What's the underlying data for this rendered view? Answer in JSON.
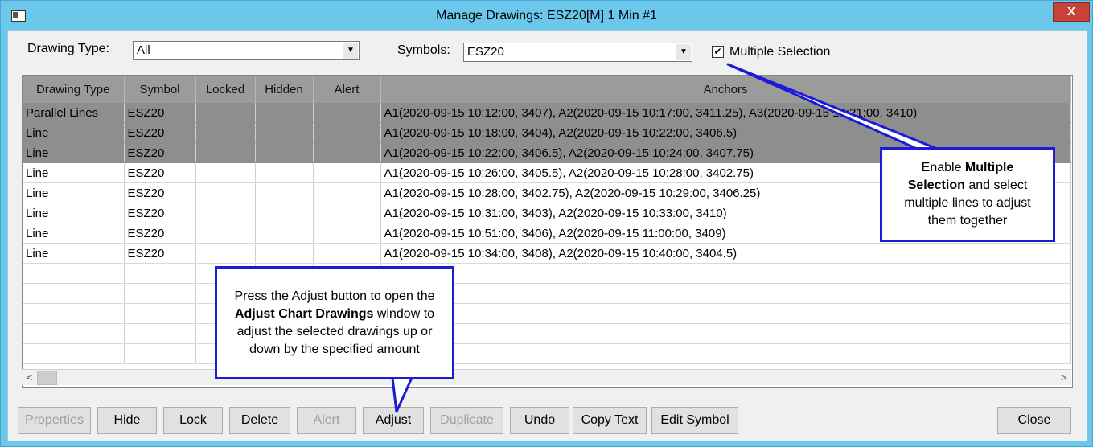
{
  "window": {
    "title": "Manage Drawings: ESZ20[M]  1 Min   #1",
    "close_label": "X"
  },
  "filters": {
    "drawing_type_label": "Drawing Type:",
    "drawing_type_value": "All",
    "symbols_label": "Symbols:",
    "symbols_value": "ESZ20",
    "multiple_selection_label": "Multiple Selection",
    "multiple_selection_checked": "✔"
  },
  "table": {
    "columns": [
      "Drawing Type",
      "Symbol",
      "Locked",
      "Hidden",
      "Alert",
      "Anchors"
    ],
    "rows": [
      {
        "type": "Parallel Lines",
        "symbol": "ESZ20",
        "locked": "",
        "hidden": "",
        "alert": "",
        "anchors": "A1(2020-09-15  10:12:00, 3407), A2(2020-09-15  10:17:00, 3411.25), A3(2020-09-15  10:21:00, 3410)",
        "selected": true
      },
      {
        "type": "Line",
        "symbol": "ESZ20",
        "locked": "",
        "hidden": "",
        "alert": "",
        "anchors": "A1(2020-09-15  10:18:00, 3404), A2(2020-09-15  10:22:00, 3406.5)",
        "selected": true
      },
      {
        "type": "Line",
        "symbol": "ESZ20",
        "locked": "",
        "hidden": "",
        "alert": "",
        "anchors": "A1(2020-09-15  10:22:00, 3406.5), A2(2020-09-15  10:24:00, 3407.75)",
        "selected": true
      },
      {
        "type": "Line",
        "symbol": "ESZ20",
        "locked": "",
        "hidden": "",
        "alert": "",
        "anchors": "A1(2020-09-15  10:26:00, 3405.5), A2(2020-09-15  10:28:00, 3402.75)",
        "selected": false
      },
      {
        "type": "Line",
        "symbol": "ESZ20",
        "locked": "",
        "hidden": "",
        "alert": "",
        "anchors": "A1(2020-09-15  10:28:00, 3402.75), A2(2020-09-15  10:29:00, 3406.25)",
        "selected": false
      },
      {
        "type": "Line",
        "symbol": "ESZ20",
        "locked": "",
        "hidden": "",
        "alert": "",
        "anchors": "A1(2020-09-15  10:31:00, 3403), A2(2020-09-15  10:33:00, 3410)",
        "selected": false
      },
      {
        "type": "Line",
        "symbol": "ESZ20",
        "locked": "",
        "hidden": "",
        "alert": "",
        "anchors": "A1(2020-09-15  10:51:00, 3406), A2(2020-09-15  11:00:00, 3409)",
        "selected": false
      },
      {
        "type": "Line",
        "symbol": "ESZ20",
        "locked": "",
        "hidden": "",
        "alert": "",
        "anchors": "A1(2020-09-15  10:34:00, 3408), A2(2020-09-15  10:40:00, 3404.5)",
        "selected": false
      }
    ]
  },
  "buttons": {
    "properties": "Properties",
    "hide": "Hide",
    "lock": "Lock",
    "delete": "Delete",
    "alert": "Alert",
    "adjust": "Adjust",
    "duplicate": "Duplicate",
    "undo": "Undo",
    "copy_text": "Copy Text",
    "edit_symbol": "Edit Symbol",
    "close": "Close"
  },
  "callouts": {
    "multiple_selection": {
      "t1": "Enable ",
      "b1": "Multiple Selection",
      "t2": " and select multiple lines to adjust them together"
    },
    "adjust": {
      "t1": "Press the Adjust button to open the ",
      "b1": "Adjust Chart Drawings",
      "t2": " window to adjust the selected drawings up or down by the specified amount"
    }
  },
  "colors": {
    "title_bar": "#6cc8eb",
    "callout_border": "#1c1cd6",
    "selected_row": "#8e8e8e",
    "header_bg": "#9b9b9b"
  },
  "icons": [
    "app-icon",
    "close-icon",
    "dropdown-arrow-icon",
    "checkbox-check-icon",
    "scroll-left-icon",
    "scroll-right-icon"
  ]
}
